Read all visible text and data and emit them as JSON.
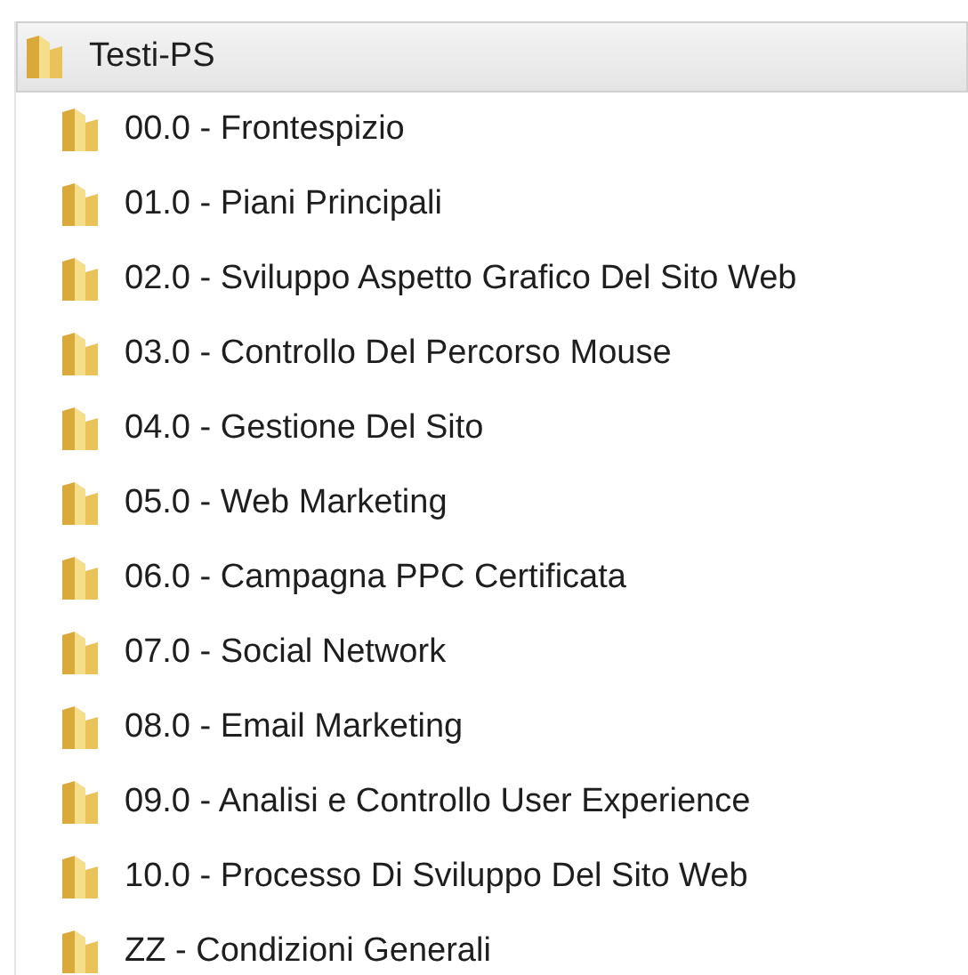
{
  "tree": {
    "label": "Testi-PS",
    "selected": true,
    "children": [
      {
        "label": "00.0 - Frontespizio",
        "selected": false
      },
      {
        "label": "01.0 - Piani Principali",
        "selected": false
      },
      {
        "label": "02.0 - Sviluppo Aspetto Grafico Del Sito Web",
        "selected": false
      },
      {
        "label": "03.0 - Controllo Del Percorso Mouse",
        "selected": false
      },
      {
        "label": "04.0 - Gestione Del Sito",
        "selected": false
      },
      {
        "label": "05.0 - Web Marketing",
        "selected": false
      },
      {
        "label": "06.0 - Campagna PPC Certificata",
        "selected": false
      },
      {
        "label": "07.0 - Social Network",
        "selected": false
      },
      {
        "label": "08.0 - Email Marketing",
        "selected": false
      },
      {
        "label": "09.0 - Analisi e Controllo User Experience",
        "selected": false
      },
      {
        "label": "10.0 - Processo Di Sviluppo Del Sito Web",
        "selected": false
      },
      {
        "label": "ZZ - Condizioni Generali",
        "selected": false
      }
    ]
  }
}
